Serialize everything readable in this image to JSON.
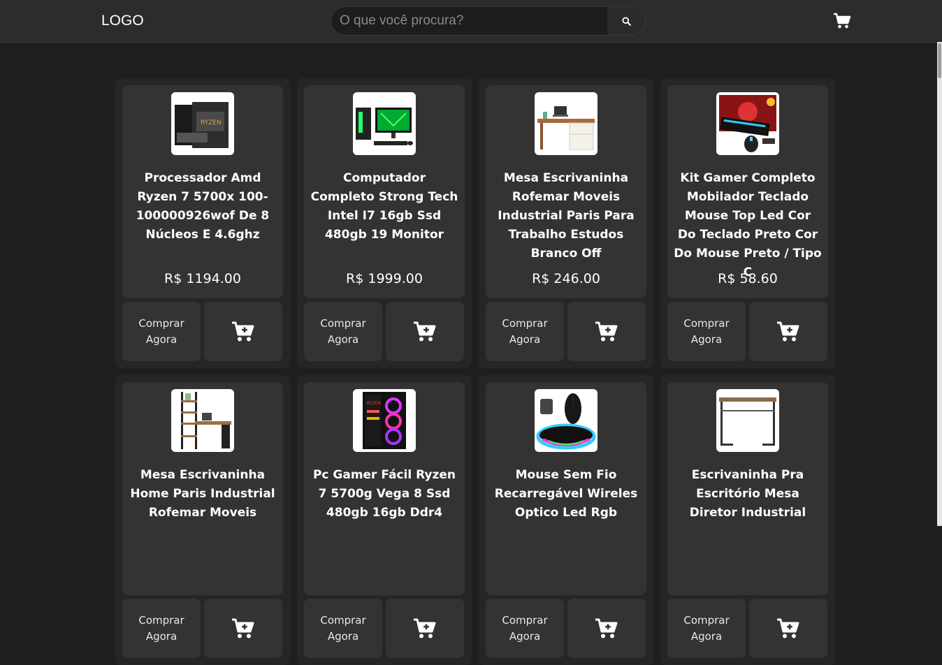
{
  "header": {
    "logo": "LOGO",
    "search_placeholder": "O que você procura?"
  },
  "colors": {
    "page_bg": "#1f1f1f",
    "header_bg": "#2c2c2c",
    "card_bg": "#262626",
    "panel_bg": "#333333",
    "text": "#ffffff"
  },
  "icons": {
    "search": "search-icon",
    "cart": "cart-icon",
    "add_to_cart": "cart-plus-icon"
  },
  "products": [
    {
      "title": "Processador Amd Ryzen 7 5700x 100-100000926wof De 8 Núcleos E 4.6ghz",
      "price": "R$ 1194.00",
      "buy_label": "Comprar Agora",
      "image": "cpu-box"
    },
    {
      "title": "Computador Completo Strong Tech Intel I7 16gb Ssd 480gb 19 Monitor",
      "price": "R$ 1999.00",
      "buy_label": "Comprar Agora",
      "image": "desktop-pc"
    },
    {
      "title": "Mesa Escrivaninha Rofemar Moveis Industrial Paris Para Trabalho Estudos Branco Off",
      "price": "R$ 246.00",
      "buy_label": "Comprar Agora",
      "image": "desk"
    },
    {
      "title": "Kit Gamer Completo Mobilador Teclado Mouse Top Led Cor Do Teclado Preto Cor Do Mouse Preto / Tipo C",
      "price": "R$ 58.60",
      "buy_label": "Comprar Agora",
      "image": "gamer-kit"
    },
    {
      "title": "Mesa Escrivaninha Home Paris Industrial Rofemar Moveis",
      "price": "",
      "buy_label": "Comprar Agora",
      "image": "shelf-desk"
    },
    {
      "title": "Pc Gamer Fácil Ryzen 7 5700g Vega 8 Ssd 480gb 16gb Ddr4",
      "price": "",
      "buy_label": "Comprar Agora",
      "image": "gamer-pc"
    },
    {
      "title": "Mouse Sem Fio Recarregável Wireles Optico Led Rgb",
      "price": "",
      "buy_label": "Comprar Agora",
      "image": "rgb-mouse"
    },
    {
      "title": "Escrivaninha Pra Escritório Mesa Diretor Industrial",
      "price": "",
      "buy_label": "Comprar Agora",
      "image": "simple-desk"
    }
  ]
}
